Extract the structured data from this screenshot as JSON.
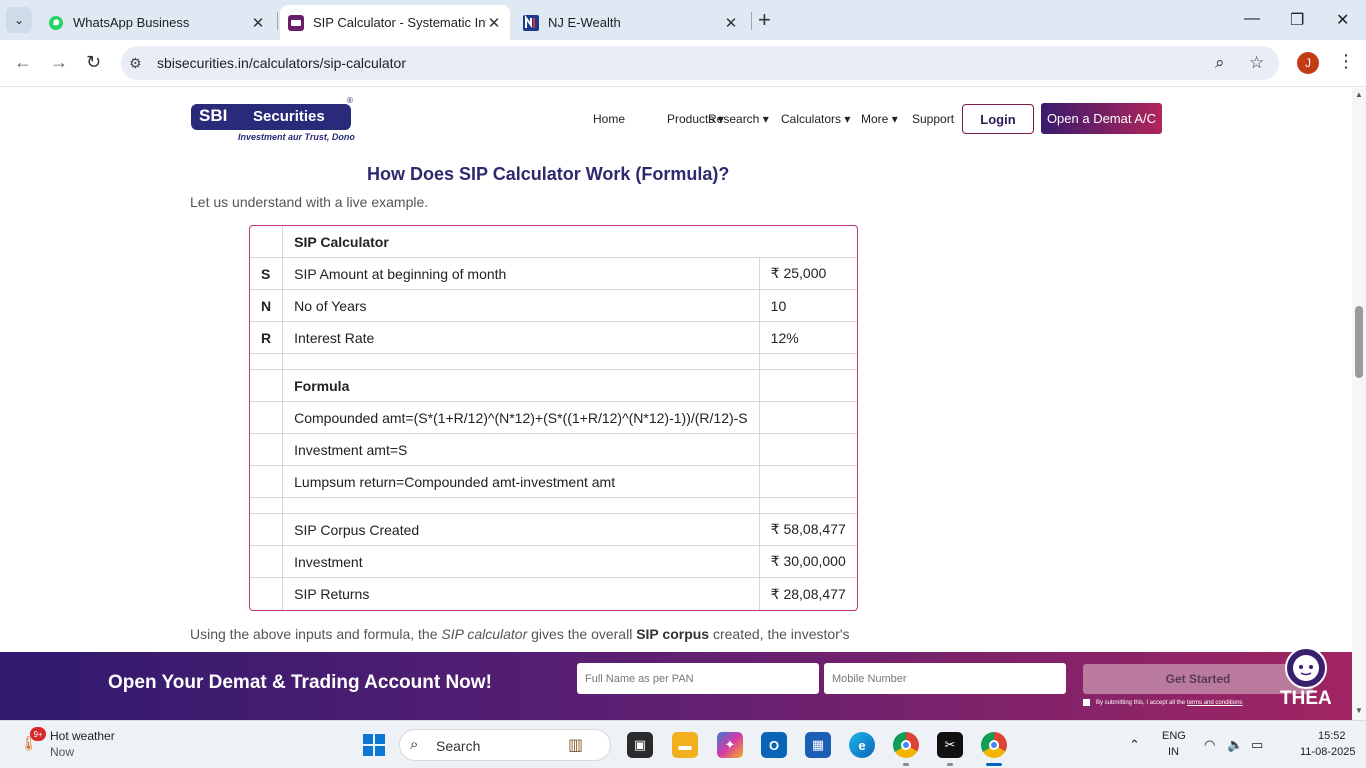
{
  "browser": {
    "tabs": [
      {
        "label": "WhatsApp Business"
      },
      {
        "label": "SIP Calculator - Systematic Inve"
      },
      {
        "label": "NJ E-Wealth"
      }
    ],
    "url": "sbisecurities.in/calculators/sip-calculator",
    "profile_initial": "J",
    "icons": [
      "chevron-down-icon",
      "back-icon",
      "forward-icon",
      "reload-icon",
      "site-settings-icon",
      "zoom-icon",
      "star-icon",
      "kebab-menu-icon"
    ]
  },
  "header": {
    "logo_sbi": "SBI",
    "logo_securities": "Securities",
    "logo_tagline": "Investment aur Trust, Dono",
    "nav": [
      {
        "label": "Home",
        "caret": ""
      },
      {
        "label": "Products",
        "caret": "▾"
      },
      {
        "label": "Research",
        "caret": "▾"
      },
      {
        "label": "Calculators",
        "caret": "▾"
      },
      {
        "label": "More",
        "caret": "▾"
      },
      {
        "label": "Support",
        "caret": ""
      }
    ],
    "login_label": "Login",
    "demat_label": "Open a Demat A/C",
    "brand_color": "#2a2a7a",
    "accent_color": "#b0265a"
  },
  "content": {
    "heading": "How Does SIP Calculator Work (Formula)?",
    "intro": "Let us understand with a live example.",
    "table": {
      "rows": [
        {
          "c1": "",
          "c2": "SIP Calculator",
          "c3": "",
          "bold": true,
          "merged": true
        },
        {
          "c1": "S",
          "c2": "SIP Amount at beginning of month",
          "c3": "₹ 25,000"
        },
        {
          "c1": "N",
          "c2": "No of Years",
          "c3": "10"
        },
        {
          "c1": "R",
          "c2": "Interest Rate",
          "c3": "12%"
        },
        {
          "c1": "",
          "c2": "",
          "c3": "",
          "spacer": true
        },
        {
          "c1": "",
          "c2": "Formula",
          "c3": "",
          "bold": true
        },
        {
          "c1": "",
          "c2": "Compounded amt=(S*(1+R/12)^(N*12)+(S*((1+R/12)^(N*12)-1))/(R/12)-S",
          "c3": ""
        },
        {
          "c1": "",
          "c2": "Investment amt=S",
          "c3": ""
        },
        {
          "c1": "",
          "c2": "Lumpsum return=Compounded amt-investment amt",
          "c3": ""
        },
        {
          "c1": "",
          "c2": "",
          "c3": "",
          "spacer": true
        },
        {
          "c1": "",
          "c2": "SIP Corpus Created",
          "c3": "₹ 58,08,477"
        },
        {
          "c1": "",
          "c2": "Investment",
          "c3": "₹ 30,00,000"
        },
        {
          "c1": "",
          "c2": "SIP Returns",
          "c3": "₹ 28,08,477"
        }
      ]
    },
    "para": {
      "t1": "Using the above inputs and formula, the ",
      "t2": "SIP calculator",
      "t3": " gives the overall ",
      "t4": "SIP corpus",
      "t5": " created, the investor's"
    }
  },
  "banner": {
    "title": "Open Your Demat & Trading Account Now!",
    "name_placeholder": "Full Name as per PAN",
    "mobile_placeholder": "Mobile Number",
    "cta_label": "Get Started",
    "consent_text": "By submitting this, I accept all the",
    "consent_link": "terms and conditions",
    "bot_label": "THEA"
  },
  "taskbar": {
    "weather_badge": "9+",
    "weather_title": "Hot weather",
    "weather_sub": "Now",
    "search_label": "Search",
    "lang1": "ENG",
    "lang2": "IN",
    "time": "15:52",
    "date": "11-08-2025"
  }
}
